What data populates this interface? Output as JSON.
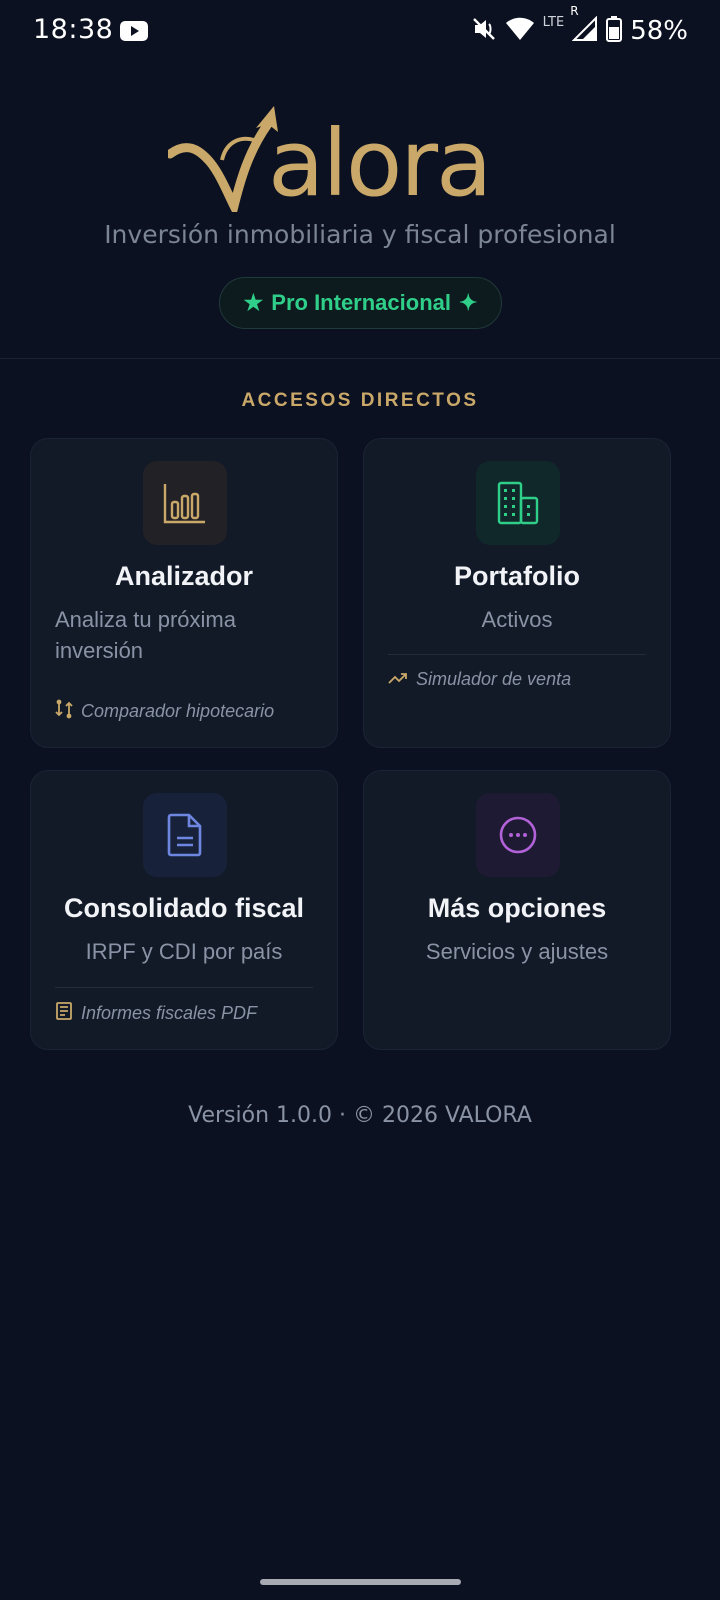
{
  "status_bar": {
    "time": "18:38",
    "lte": "LTE",
    "roaming": "R",
    "battery": "58%",
    "icons": [
      "youtube-icon",
      "mute-icon",
      "wifi-icon",
      "signal-icon",
      "battery-icon"
    ]
  },
  "brand": {
    "name": "alora",
    "tagline": "Inversión inmobiliaria y fiscal profesional",
    "badge": "Pro Internacional",
    "accent_color": "#c9a869",
    "badge_color": "#2fcf8a"
  },
  "section": {
    "title": "ACCESOS DIRECTOS"
  },
  "cards": [
    {
      "title": "Analizador",
      "subtitle": "Analiza tu próxima inversión",
      "footer": "Comparador hipotecario",
      "icon": "bar-chart-icon",
      "footer_icon": "compare-arrows-icon"
    },
    {
      "title": "Portafolio",
      "subtitle": "Activos",
      "footer": "Simulador de venta",
      "icon": "buildings-icon",
      "footer_icon": "trending-up-icon"
    },
    {
      "title": "Consolidado fiscal",
      "subtitle": "IRPF y CDI por país",
      "footer": "Informes fiscales PDF",
      "icon": "document-icon",
      "footer_icon": "receipt-icon"
    },
    {
      "title": "Más opciones",
      "subtitle": "Servicios y ajustes",
      "icon": "more-icon"
    }
  ],
  "footer": {
    "version": "Versión 1.0.0 · © 2026 VALORA"
  }
}
